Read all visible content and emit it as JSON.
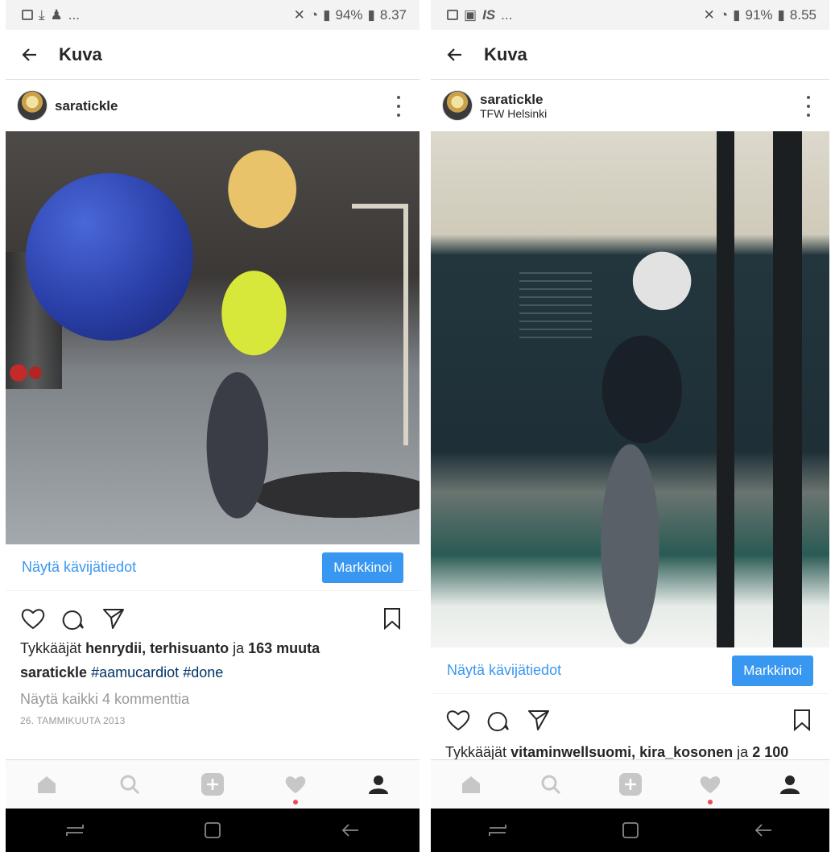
{
  "colors": {
    "accent": "#3897f0",
    "hashtag": "#003569",
    "notification": "#ed4956"
  },
  "screens": [
    {
      "status": {
        "time": "8.37",
        "battery": "94%"
      },
      "title": "Kuva",
      "post": {
        "username": "saratickle",
        "location": "",
        "insights_label": "Näytä kävijätiedot",
        "promote_label": "Markkinoi",
        "likes_prefix": "Tykkääjät",
        "likers": "henrydii, terhisuanto",
        "likes_join": "ja",
        "likes_rest": "163 muuta",
        "caption_user": "saratickle",
        "tags": [
          "#aamucardiot",
          "#done"
        ],
        "comments_link": "Näytä kaikki 4 kommenttia",
        "date": "26. TAMMIKUUTA 2013"
      }
    },
    {
      "status": {
        "time": "8.55",
        "battery": "91%"
      },
      "title": "Kuva",
      "post": {
        "username": "saratickle",
        "location": "TFW Helsinki",
        "insights_label": "Näytä kävijätiedot",
        "promote_label": "Markkinoi",
        "likes_prefix": "Tykkääjät",
        "likers": "vitaminwellsuomi, kira_kosonen",
        "likes_join": "ja",
        "likes_rest": "2 100"
      }
    }
  ],
  "icons": {
    "status_left": [
      "gallery-icon",
      "download-icon",
      "notification-icon"
    ],
    "status_left_right": [
      "gallery-icon",
      "flipboard-icon",
      "is-news-icon"
    ],
    "actions": [
      "heart-icon",
      "comment-icon",
      "share-icon",
      "bookmark-icon"
    ],
    "tabs": [
      "home-icon",
      "search-icon",
      "add-icon",
      "activity-icon",
      "profile-icon"
    ],
    "nav": [
      "recents-icon",
      "home-button-icon",
      "back-icon"
    ]
  },
  "ellipsis": "..."
}
